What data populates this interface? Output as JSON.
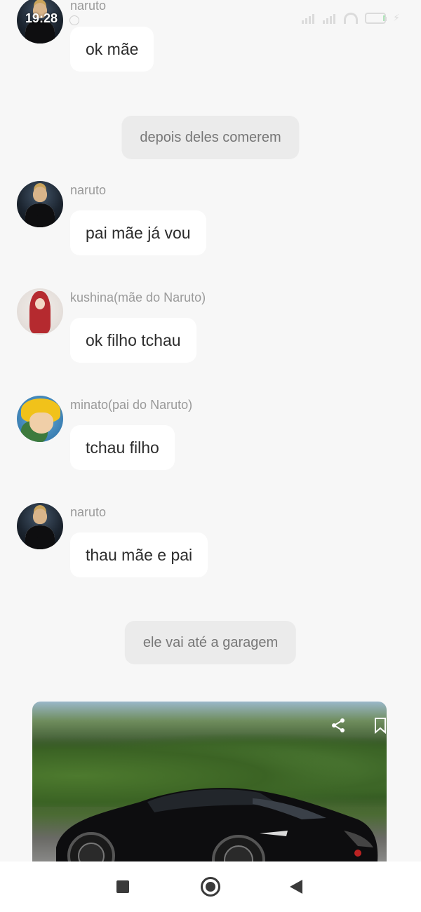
{
  "status_bar": {
    "time": "19:28",
    "icons": [
      "signal-icon",
      "signal-icon",
      "wifi-icon",
      "battery-icon",
      "charging-icon"
    ]
  },
  "messages": [
    {
      "type": "chat",
      "sender": "naruto",
      "avatar": "naruto",
      "text": "ok mãe"
    },
    {
      "type": "narration",
      "text": "depois deles comerem"
    },
    {
      "type": "chat",
      "sender": "naruto",
      "avatar": "naruto",
      "text": "pai mãe já vou"
    },
    {
      "type": "chat",
      "sender": "kushina(mãe do Naruto)",
      "avatar": "kushina",
      "text": "ok filho tchau"
    },
    {
      "type": "chat",
      "sender": "minato(pai do Naruto)",
      "avatar": "minato",
      "text": "tchau filho"
    },
    {
      "type": "chat",
      "sender": "naruto",
      "avatar": "naruto",
      "text": "thau mãe e pai"
    },
    {
      "type": "narration",
      "text": "ele vai até a garagem"
    }
  ],
  "image_card": {
    "subject": "black sports car in front of green hedges",
    "actions": [
      "share-icon",
      "bookmark-icon"
    ]
  },
  "nav_bar": {
    "buttons": [
      "recents-button",
      "home-button",
      "back-button"
    ]
  },
  "colors": {
    "background": "#f7f7f7",
    "bubble": "#ffffff",
    "narration_bubble": "#ebebeb",
    "sender_text": "#9a9a9a",
    "message_text": "#2c2c2c"
  }
}
